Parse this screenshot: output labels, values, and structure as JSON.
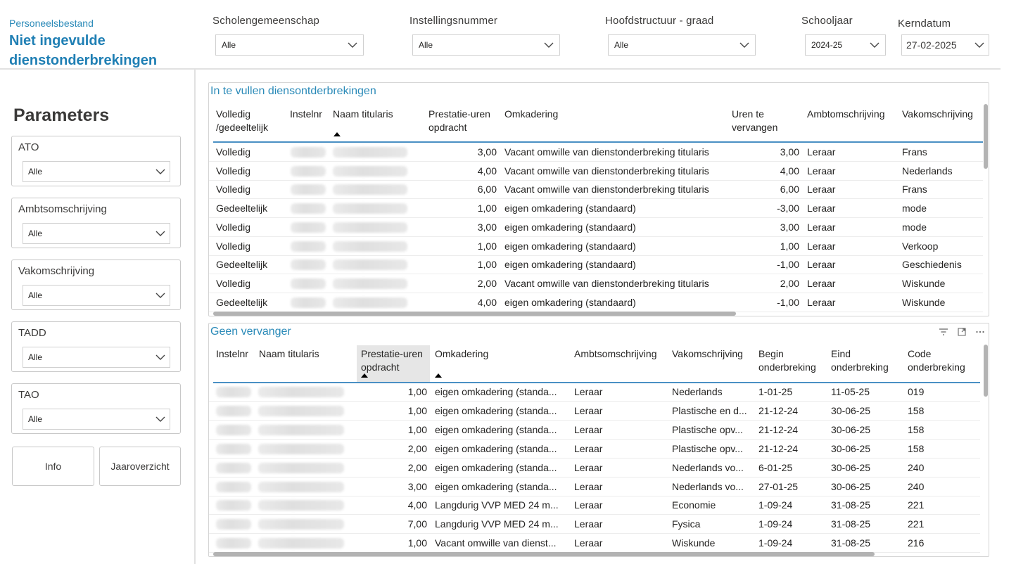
{
  "header": {
    "subtitle": "Personeelsbestand",
    "title": "Niet ingevulde dienstonderbrekingen",
    "filters": [
      {
        "label": "Scholengemeenschap",
        "value": "Alle"
      },
      {
        "label": "Instellingsnummer",
        "value": "Alle"
      },
      {
        "label": "Hoofdstructuur - graad",
        "value": "Alle"
      },
      {
        "label": "Schooljaar",
        "value": "2024-25"
      },
      {
        "label": "Kerndatum",
        "value": "27-02-2025"
      }
    ]
  },
  "sidebar": {
    "title": "Parameters",
    "params": [
      {
        "label": "ATO",
        "value": "Alle"
      },
      {
        "label": "Ambtsomschrijving",
        "value": "Alle"
      },
      {
        "label": "Vakomschrijving",
        "value": "Alle"
      },
      {
        "label": "TADD",
        "value": "Alle"
      },
      {
        "label": "TAO",
        "value": "Alle"
      }
    ],
    "buttons": {
      "info": "Info",
      "jaaroverzicht": "Jaaroverzicht"
    }
  },
  "table1": {
    "title": "In te vullen diensontderbrekingen",
    "headers": {
      "volledig": "Volledig /gedeeltelijk",
      "instelnr": "Instelnr",
      "naam": "Naam titularis",
      "prestatie": "Prestatie-uren opdracht",
      "omkadering": "Omkadering",
      "uren": "Uren te vervangen",
      "ambt": "Ambtomschrijving",
      "vak": "Vakomschrijving"
    },
    "rows": [
      {
        "type": "Volledig",
        "prest": "3,00",
        "omk": "Vacant omwille van dienstonderbreking titularis",
        "uren": "3,00",
        "ambt": "Leraar",
        "vak": "Frans"
      },
      {
        "type": "Volledig",
        "prest": "4,00",
        "omk": "Vacant omwille van dienstonderbreking titularis",
        "uren": "4,00",
        "ambt": "Leraar",
        "vak": "Nederlands"
      },
      {
        "type": "Volledig",
        "prest": "6,00",
        "omk": "Vacant omwille van dienstonderbreking titularis",
        "uren": "6,00",
        "ambt": "Leraar",
        "vak": "Frans"
      },
      {
        "type": "Gedeeltelijk",
        "prest": "1,00",
        "omk": "eigen omkadering (standaard)",
        "uren": "-3,00",
        "ambt": "Leraar",
        "vak": "mode"
      },
      {
        "type": "Volledig",
        "prest": "3,00",
        "omk": "eigen omkadering (standaard)",
        "uren": "3,00",
        "ambt": "Leraar",
        "vak": "mode"
      },
      {
        "type": "Volledig",
        "prest": "1,00",
        "omk": "eigen omkadering (standaard)",
        "uren": "1,00",
        "ambt": "Leraar",
        "vak": "Verkoop"
      },
      {
        "type": "Gedeeltelijk",
        "prest": "1,00",
        "omk": "eigen omkadering (standaard)",
        "uren": "-1,00",
        "ambt": "Leraar",
        "vak": "Geschiedenis"
      },
      {
        "type": "Volledig",
        "prest": "2,00",
        "omk": "Vacant omwille van dienstonderbreking titularis",
        "uren": "2,00",
        "ambt": "Leraar",
        "vak": "Wiskunde"
      },
      {
        "type": "Gedeeltelijk",
        "prest": "4,00",
        "omk": "eigen omkadering (standaard)",
        "uren": "-1,00",
        "ambt": "Leraar",
        "vak": "Wiskunde"
      }
    ]
  },
  "table2": {
    "title": "Geen vervanger",
    "headers": {
      "instelnr": "Instelnr",
      "naam": "Naam titularis",
      "prestatie": "Prestatie-uren opdracht",
      "omkadering": "Omkadering",
      "ambt": "Ambtsomschrijving",
      "vak": "Vakomschrijving",
      "begin": "Begin onderbreking",
      "eind": "Eind onderbreking",
      "code": "Code onderbreking"
    },
    "rows": [
      {
        "prest": "1,00",
        "omk": "eigen omkadering (standa...",
        "ambt": "Leraar",
        "vak": "Nederlands",
        "begin": "1-01-25",
        "eind": "11-05-25",
        "code": "019"
      },
      {
        "prest": "1,00",
        "omk": "eigen omkadering (standa...",
        "ambt": "Leraar",
        "vak": "Plastische en d...",
        "begin": "21-12-24",
        "eind": "30-06-25",
        "code": "158"
      },
      {
        "prest": "1,00",
        "omk": "eigen omkadering (standa...",
        "ambt": "Leraar",
        "vak": "Plastische opv...",
        "begin": "21-12-24",
        "eind": "30-06-25",
        "code": "158"
      },
      {
        "prest": "2,00",
        "omk": "eigen omkadering (standa...",
        "ambt": "Leraar",
        "vak": "Plastische opv...",
        "begin": "21-12-24",
        "eind": "30-06-25",
        "code": "158"
      },
      {
        "prest": "2,00",
        "omk": "eigen omkadering (standa...",
        "ambt": "Leraar",
        "vak": "Nederlands vo...",
        "begin": "6-01-25",
        "eind": "30-06-25",
        "code": "240"
      },
      {
        "prest": "3,00",
        "omk": "eigen omkadering (standa...",
        "ambt": "Leraar",
        "vak": "Nederlands vo...",
        "begin": "27-01-25",
        "eind": "30-06-25",
        "code": "240"
      },
      {
        "prest": "4,00",
        "omk": "Langdurig VVP MED 24 m...",
        "ambt": "Leraar",
        "vak": "Economie",
        "begin": "1-09-24",
        "eind": "31-08-25",
        "code": "221"
      },
      {
        "prest": "7,00",
        "omk": "Langdurig VVP MED 24 m...",
        "ambt": "Leraar",
        "vak": "Fysica",
        "begin": "1-09-24",
        "eind": "31-08-25",
        "code": "221"
      },
      {
        "prest": "1,00",
        "omk": "Vacant omwille van dienst...",
        "ambt": "Leraar",
        "vak": "Wiskunde",
        "begin": "1-09-24",
        "eind": "31-08-25",
        "code": "216"
      }
    ]
  }
}
